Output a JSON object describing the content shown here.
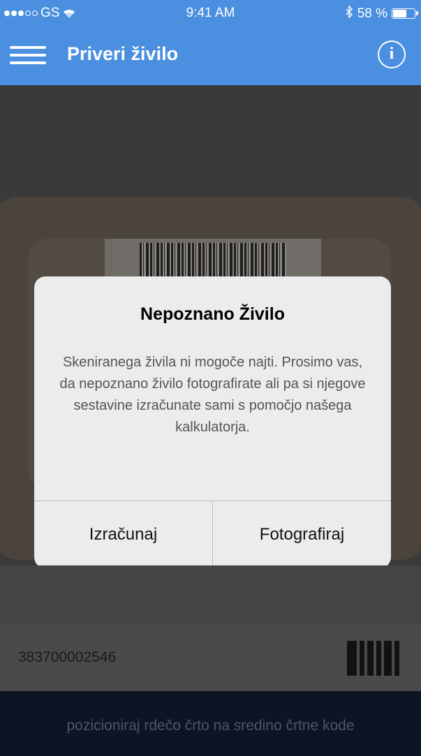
{
  "status_bar": {
    "carrier": "GS",
    "time": "9:41 AM",
    "battery": "58 %",
    "battery_level": 0.58,
    "signal_dots_filled": 3,
    "signal_dots_total": 5,
    "icons": [
      "signal-dots-icon",
      "wifi-icon",
      "bluetooth-icon",
      "battery-icon"
    ]
  },
  "header": {
    "title": "Priveri živilo",
    "menu_icon": "hamburger-menu-icon",
    "info_icon": "info-icon",
    "info_glyph": "i"
  },
  "dialog": {
    "title": "Nepoznano Živilo",
    "message": "Skeniranega živila ni mogoče najti. Prosimo vas, da nepoznano živilo fotografirate ali pa si njegove sestavine izračunate sami s pomočjo našega kalkulatorja.",
    "buttons": {
      "calculate": "Izračunaj",
      "photograph": "Fotografiraj"
    }
  },
  "scan": {
    "code": "383700002546",
    "icon": "barcode-icon"
  },
  "hint": {
    "text": "pozicioniraj rdečo črto na sredino črtne kode"
  },
  "colors": {
    "header": "#4a8fe0",
    "dialog_bg": "#ececec",
    "hint_bg": "#0c1524"
  }
}
